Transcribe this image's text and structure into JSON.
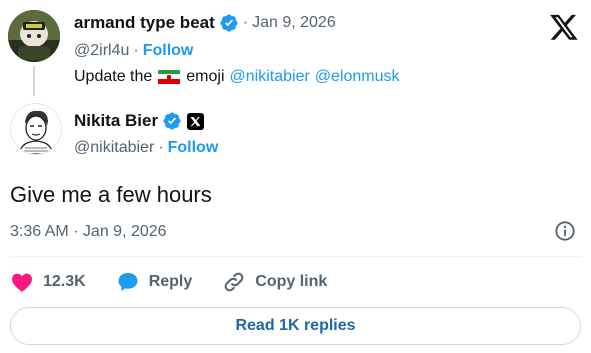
{
  "parent_tweet": {
    "author_name": "armand type beat",
    "date": "Jan 9, 2026",
    "handle": "@2irl4u",
    "follow_label": "Follow",
    "text_before": "Update the",
    "emoji": "iran-flag-emoji",
    "text_after": "emoji",
    "mentions": [
      "@nikitabier",
      "@elonmusk"
    ]
  },
  "reply_tweet": {
    "author_name": "Nikita Bier",
    "handle": "@nikitabier",
    "follow_label": "Follow",
    "text": "Give me a few hours",
    "timestamp": "3:36 AM · Jan 9, 2026"
  },
  "actions": {
    "like_count": "12.3K",
    "reply_label": "Reply",
    "copy_label": "Copy link"
  },
  "read_replies_label": "Read 1K replies",
  "separator": "·",
  "icons": {
    "verified": "verified-badge-icon",
    "affiliate": "x-affiliate-icon",
    "logo": "x-logo-icon",
    "info": "info-icon",
    "like": "heart-icon",
    "reply": "speech-bubble-icon",
    "copy": "link-icon"
  },
  "colors": {
    "accent": "#1d9bf0",
    "like": "#f91880",
    "muted": "#536471",
    "text": "#0f1419",
    "button_text": "#1d66a8"
  }
}
